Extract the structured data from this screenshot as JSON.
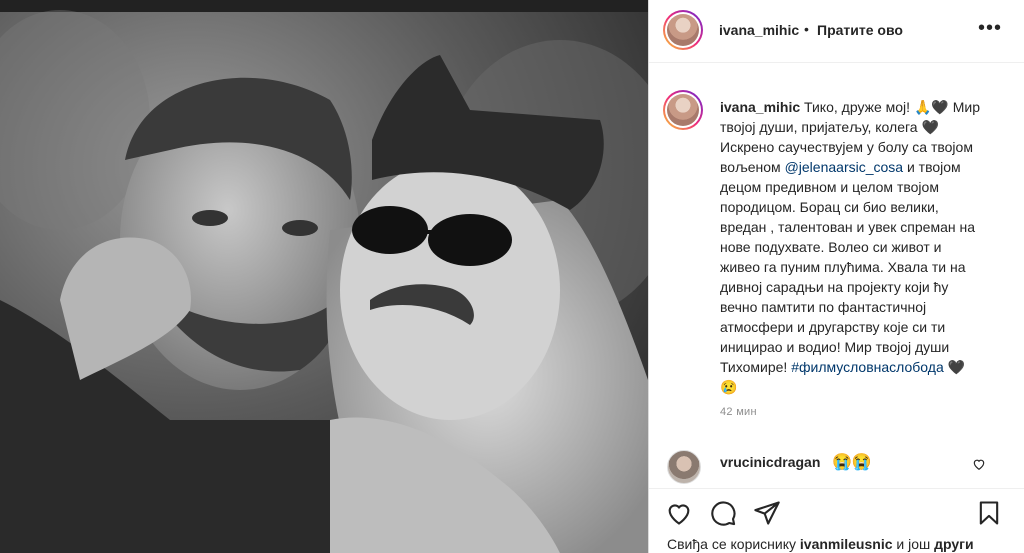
{
  "post": {
    "username": "ivana_mihic",
    "dot": "•",
    "follow_label": "Пратите ово",
    "more_icon": "more-options-icon",
    "caption_user": "ivana_mihic",
    "caption_p1": "Тико, друже мој!",
    "caption_emoji1": "🙏🖤",
    "caption_p2": "Мир твојој души, пријатељу, колега",
    "caption_emoji2": "🖤",
    "caption_p3": "Искрено саучествујем у болу са твојом вољеном",
    "caption_mention": "@jelenaarsic_cosa",
    "caption_p4": "и твојом децом предивном и целом твојом породицом. Борац си био велики, вредан , талентован и увек спреман на нове подухвате. Волео си живот и живео га пуним плућима. Хвала ти на дивној сарадњи на пројекту који ћу вечно памтити по фантастичној атмосфери и другарству које си ти иницирао и водио! Мир твојој души Тихомире!",
    "caption_hashtag": "#филмусловнаслобода",
    "caption_emoji3": "🖤😢",
    "time_label": "42 мин"
  },
  "comment": {
    "username": "vrucinicdragan",
    "emoji": "😭😭"
  },
  "likes": {
    "prefix": "Свиђа се кориснику",
    "user": "ivanmileusnic",
    "suffix": "и још",
    "others": "други"
  },
  "icons": [
    "heart-icon",
    "comment-icon",
    "share-icon",
    "bookmark-icon"
  ],
  "colors": {
    "link": "#00376b",
    "text": "#262626",
    "muted": "#8e8e8e"
  }
}
